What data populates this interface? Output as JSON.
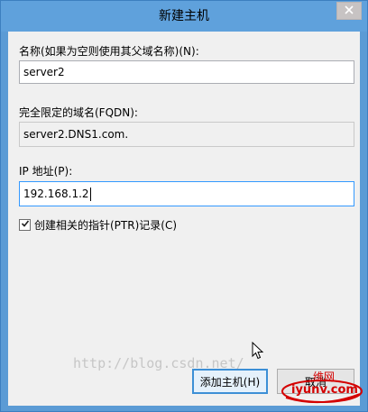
{
  "window": {
    "title": "新建主机",
    "close_icon": "close-icon"
  },
  "form": {
    "name_label": "名称(如果为空则使用其父域名称)(N):",
    "name_value": "server2",
    "fqdn_label": "完全限定的域名(FQDN):",
    "fqdn_value": "server2.DNS1.com.",
    "ip_label": "IP 地址(P):",
    "ip_value": "192.168.1.2",
    "ptr_checkbox_label": "创建相关的指针(PTR)记录(C)",
    "ptr_checked": true
  },
  "buttons": {
    "add_host_label": "添加主机(H)",
    "cancel_label": "取消"
  },
  "overlays": {
    "watermark_text": "http://blog.csdn.net/",
    "logo_text": "iyunv.com",
    "logo_secondary": "维网"
  },
  "colors": {
    "titlebar": "#5fa1dc",
    "client_bg": "#f0f0f0",
    "focus_border": "#3399ff",
    "default_button_border": "#3c8fd6"
  }
}
